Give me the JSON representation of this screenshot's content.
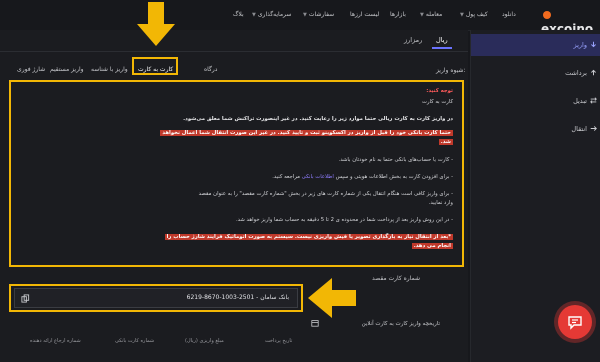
{
  "header": {
    "logo": "excoino",
    "nav": [
      "دانلود",
      "کیف پول",
      "معامله",
      "بازارها",
      "لیست ارزها",
      "سفارشات",
      "سرمایه‌گذاری",
      "بلاگ"
    ]
  },
  "sidebar": {
    "items": [
      {
        "label": "واریز",
        "icon": "arrow-down-icon"
      },
      {
        "label": "برداشت",
        "icon": "arrow-up-icon"
      },
      {
        "label": "تبدیل",
        "icon": "swap-icon"
      },
      {
        "label": "انتقال",
        "icon": "transfer-icon"
      }
    ]
  },
  "tabs": {
    "rial": "ریال",
    "crypto": "رمزارز"
  },
  "method": {
    "label": "شیوه واریز:",
    "options": [
      "درگاه",
      "کارت به کارت",
      "واریز با شناسه",
      "واریز مستقیم",
      "شارژ فوری"
    ]
  },
  "notice": {
    "title": "توجه کنید:",
    "subtitle": "کارت به کارت",
    "line1": "در واریز کارت به کارت ریالی حتما موارد زیر را رعایت کنید. در غیر اینصورت تراکنش شما معلق می‌شود.",
    "line2": "حتما کارت بانکی خود را قبل از واریز در اکسکوینو ثبت و تایید کنید. در غیر این صورت انتقال شما اعمال نخواهد",
    "line2b": "شد.",
    "line3": "- کارت یا حساب‌های بانکی حتما به نام خودتان باشد.",
    "line4a": "- برای افزودن کارت به بخش اطلاعات هویتی و سپس",
    "line4link": "اطلاعات بانکی",
    "line4b": "مراجعه کنید.",
    "line5": "- برای واریز کافی است هنگام انتقال یکی از شماره کارت های زیر در بخش \"شماره کارت مقصد\" را به عنوان مقصد",
    "line5b": "وارد نمایید.",
    "line6": "- در این روش واریز بعد از پرداخت شما در محدوده ی 2 تا 5 دقیقه به حساب شما واریز خواهد شد.",
    "line7": "*بعد از انتقال نیاز به بارگذاری تصویر یا فیش واریزی نیست. سیستم به صورت اتوماتیک فرایند شارژ حساب را",
    "line7b": "انجام می دهد."
  },
  "card": {
    "label": "شماره کارت مقصد",
    "value": "بانک سامان - 2501-1003-8670-6219"
  },
  "history": {
    "title": "تاریخچه واریز کارت به کارت آنلاین",
    "columns": [
      "تاریخ پرداخت",
      "مبلغ واریزی (ریال)",
      "شماره کارت بانکی",
      "شماره ارجاع ارائه دهنده"
    ]
  },
  "colors": {
    "highlight": "#f2b705",
    "accent": "#6b73ff",
    "danger": "#c0392b",
    "brand": "#f26b1f"
  }
}
